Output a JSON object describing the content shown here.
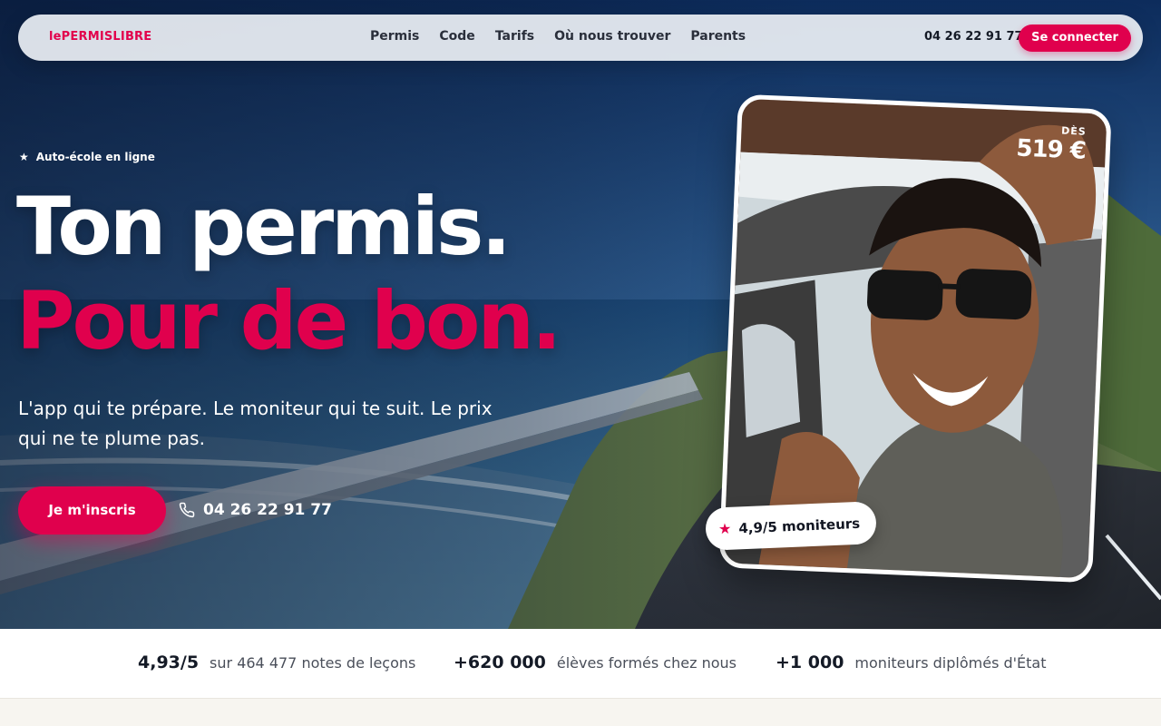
{
  "brand": {
    "logo": "lePERMISLIBRE",
    "accent": "#e0004d"
  },
  "nav": {
    "links": [
      "Permis",
      "Code",
      "Tarifs",
      "Où nous trouver",
      "Parents"
    ],
    "phone": "04 26 22 91 77",
    "login_label": "Se connecter"
  },
  "hero": {
    "eyebrow": "Auto-école en ligne",
    "title_line1": "Ton permis.",
    "title_line2": "Pour de bon.",
    "lead": "L'app qui te prépare. Le moniteur qui te suit. Le prix qui ne te plume pas.",
    "cta_label": "Je m'inscris",
    "phone": "04 26 22 91 77"
  },
  "card": {
    "price_prefix": "DÈS",
    "price": "519 €",
    "rating": "4,9/5 moniteurs"
  },
  "stats": [
    {
      "value": "4,93/5",
      "label": "sur 464 477 notes de leçons"
    },
    {
      "value": "+620 000",
      "label": "élèves formés chez nous"
    },
    {
      "value": "+1 000",
      "label": "moniteurs diplômés d'État"
    }
  ],
  "icons": {
    "star": "star-icon",
    "phone": "phone-icon"
  }
}
